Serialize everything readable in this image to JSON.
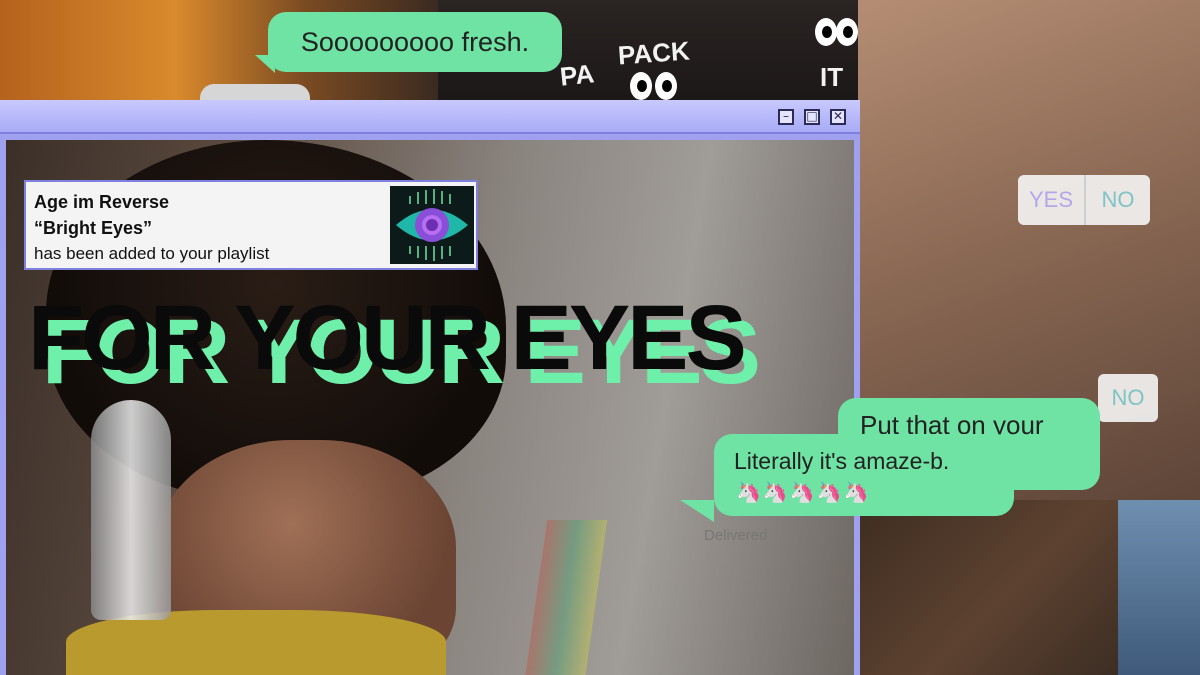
{
  "chat": {
    "bubble_fresh": "Sooooooooo fresh.",
    "bubble_putthat": "Put that on your",
    "bubble_amaze": "Literally it's amaze-b.",
    "unicorns": "🦄🦄🦄🦄🦄",
    "delivered": "Delivered"
  },
  "notification": {
    "artist": "Age im Reverse",
    "song": "“Bright Eyes”",
    "message": "has been added to your playlist",
    "album_art_icon": "eye-icon"
  },
  "headline": "FOR YOUR EYES",
  "poll": {
    "yes": "YES",
    "no": "NO"
  },
  "stickers": {
    "pack_a": "PA",
    "pack_b": "PACK",
    "pack_c": "IT"
  },
  "window": {
    "min_icon": "minimize-icon",
    "max_icon": "maximize-icon",
    "close_icon": "close-icon",
    "min_glyph": "–",
    "max_glyph": "□",
    "close_glyph": "✕"
  },
  "colors": {
    "accent_green": "#6fe3a3",
    "window_purple": "#9fa0f0",
    "headline_shadow": "#6ff0aa"
  }
}
